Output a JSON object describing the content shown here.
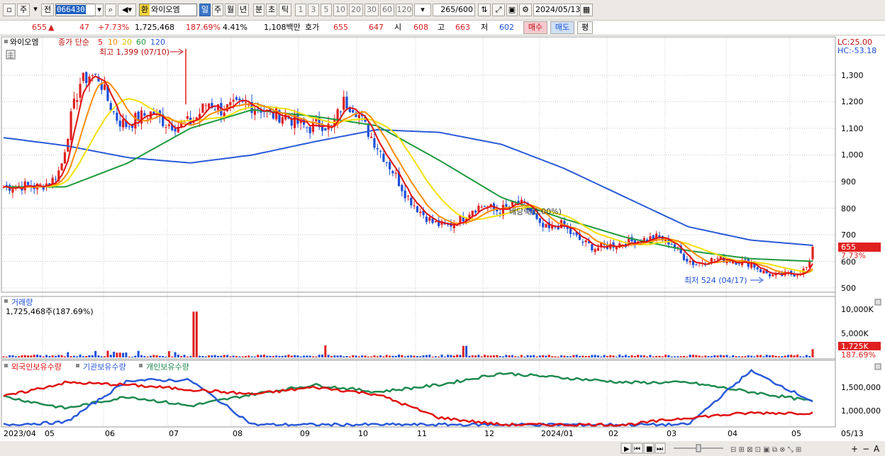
{
  "toolbar": {
    "period_type": "주",
    "prev_label": "전",
    "stock_code": "066430",
    "name_badge": "환",
    "stock_name": "와이오엠",
    "period_tabs": [
      "일",
      "주",
      "월",
      "년",
      "분",
      "초",
      "틱"
    ],
    "interval_buttons": [
      "1",
      "3",
      "5",
      "10",
      "20",
      "30",
      "60",
      "120"
    ],
    "count_display": "265",
    "count_max": "/600",
    "date": "2024/05/13"
  },
  "infobar": {
    "price": "655",
    "change_arrow": "▲",
    "change": "47",
    "change_pct": "+7.73%",
    "volume": "1,725,468",
    "volume_ratio": "187.69%",
    "turnover": "4.41%",
    "trade_value": "1,108백만",
    "quote_label": "호가",
    "ask": "655",
    "bid": "647",
    "open_label": "시",
    "open": "608",
    "high_label": "고",
    "high": "663",
    "low_label": "저",
    "low": "602",
    "buy_button": "매수",
    "sell_button": "매도",
    "eval_button": "평"
  },
  "price_panel": {
    "stock_label": "와이오엠",
    "legend_label": "종가 단순",
    "ma_periods": [
      "5",
      "10",
      "20",
      "60",
      "120"
    ],
    "ma_colors": [
      "#e01010",
      "#ff8c00",
      "#f2e000",
      "#1e9a3c",
      "#2a5ad8"
    ],
    "high_annotation": "최고 1,399 (07/10)",
    "low_annotation": "최저 524 (04/17)",
    "dividend_annotation": "배당락(0.00%)",
    "lc_label": "LC:25.00",
    "hc_label": "HC:-53.18",
    "price_tag": "655",
    "pct_tag": "7.73%",
    "y_ticks": [
      "1,300",
      "1,200",
      "1,100",
      "1,000",
      "900",
      "800",
      "700",
      "600",
      "500"
    ]
  },
  "volume_panel": {
    "title": "거래량",
    "value": "1,725,468주(187.69%)",
    "y_ticks": [
      "10,000K",
      "5,000K"
    ],
    "tag": "1,725K",
    "pct": "187.69%"
  },
  "holding_panel": {
    "series_labels": [
      "외국인보유수량",
      "기관보유수량",
      "개인보유수량"
    ],
    "series_colors": [
      "#e01010",
      "#2a5ad8",
      "#1e8a50"
    ],
    "y_ticks": [
      "1,500,000",
      "1,000,000"
    ]
  },
  "x_axis": {
    "labels": [
      "2023/04",
      "05",
      "06",
      "07",
      "08",
      "09",
      "10",
      "11",
      "12",
      "2024/01",
      "02",
      "03",
      "04",
      "05",
      "05/13"
    ]
  },
  "chart_data": {
    "type": "candlestick",
    "period": "daily",
    "price_range": [
      480,
      1430
    ],
    "ohlc_samples": [
      {
        "date": "2023/04",
        "close": 880
      },
      {
        "date": "2023/05",
        "close": 900
      },
      {
        "date": "2023/05 late",
        "close": 1300
      },
      {
        "date": "2023/06",
        "close": 1120
      },
      {
        "date": "2023/07/10",
        "high": 1399,
        "close": 1180
      },
      {
        "date": "2023/08",
        "close": 1170
      },
      {
        "date": "2023/09",
        "close": 1200
      },
      {
        "date": "2023/10",
        "close": 900
      },
      {
        "date": "2023/11",
        "close": 720
      },
      {
        "date": "2023/12",
        "close": 800
      },
      {
        "date": "2024/01",
        "close": 660
      },
      {
        "date": "2024/02",
        "close": 660
      },
      {
        "date": "2024/03",
        "close": 600
      },
      {
        "date": "2024/04/17",
        "low": 524,
        "close": 545
      },
      {
        "date": "2024/05/13",
        "open": 608,
        "high": 663,
        "low": 602,
        "close": 655
      }
    ],
    "moving_averages": {
      "ma120": [
        1065,
        1035,
        990,
        970,
        1000,
        1050,
        1095,
        1085,
        1040,
        950,
        840,
        730,
        680,
        660
      ],
      "ma60": [
        880,
        880,
        970,
        1100,
        1170,
        1145,
        1110,
        980,
        840,
        760,
        690,
        640,
        610,
        600
      ]
    },
    "volume": {
      "last": 1725468,
      "ratio_pct": 187.69,
      "peak_month": "2023/07"
    },
    "holdings_series": [
      {
        "name": "외국인보유수량",
        "values": [
          1300000,
          1600000,
          1550000,
          1450000,
          1350000,
          1500000,
          1350000,
          850000,
          700000,
          700000,
          700000,
          850000,
          950000,
          950000
        ]
      },
      {
        "name": "기관보유수량",
        "values": [
          700000,
          750000,
          1650000,
          1650000,
          700000,
          700000,
          700000,
          700000,
          700000,
          700000,
          700000,
          700000,
          1850000,
          1200000
        ]
      },
      {
        "name": "개인보유수량",
        "values": [
          1300000,
          1050000,
          1300000,
          1100000,
          1350000,
          1550000,
          1400000,
          1550000,
          1800000,
          1700000,
          1600000,
          1600000,
          1400000,
          1200000
        ]
      }
    ]
  },
  "statusbar": {
    "buttons": [
      "▶",
      "⏮",
      "■",
      "⏭"
    ],
    "tools": [
      "+",
      "−",
      "A"
    ]
  }
}
